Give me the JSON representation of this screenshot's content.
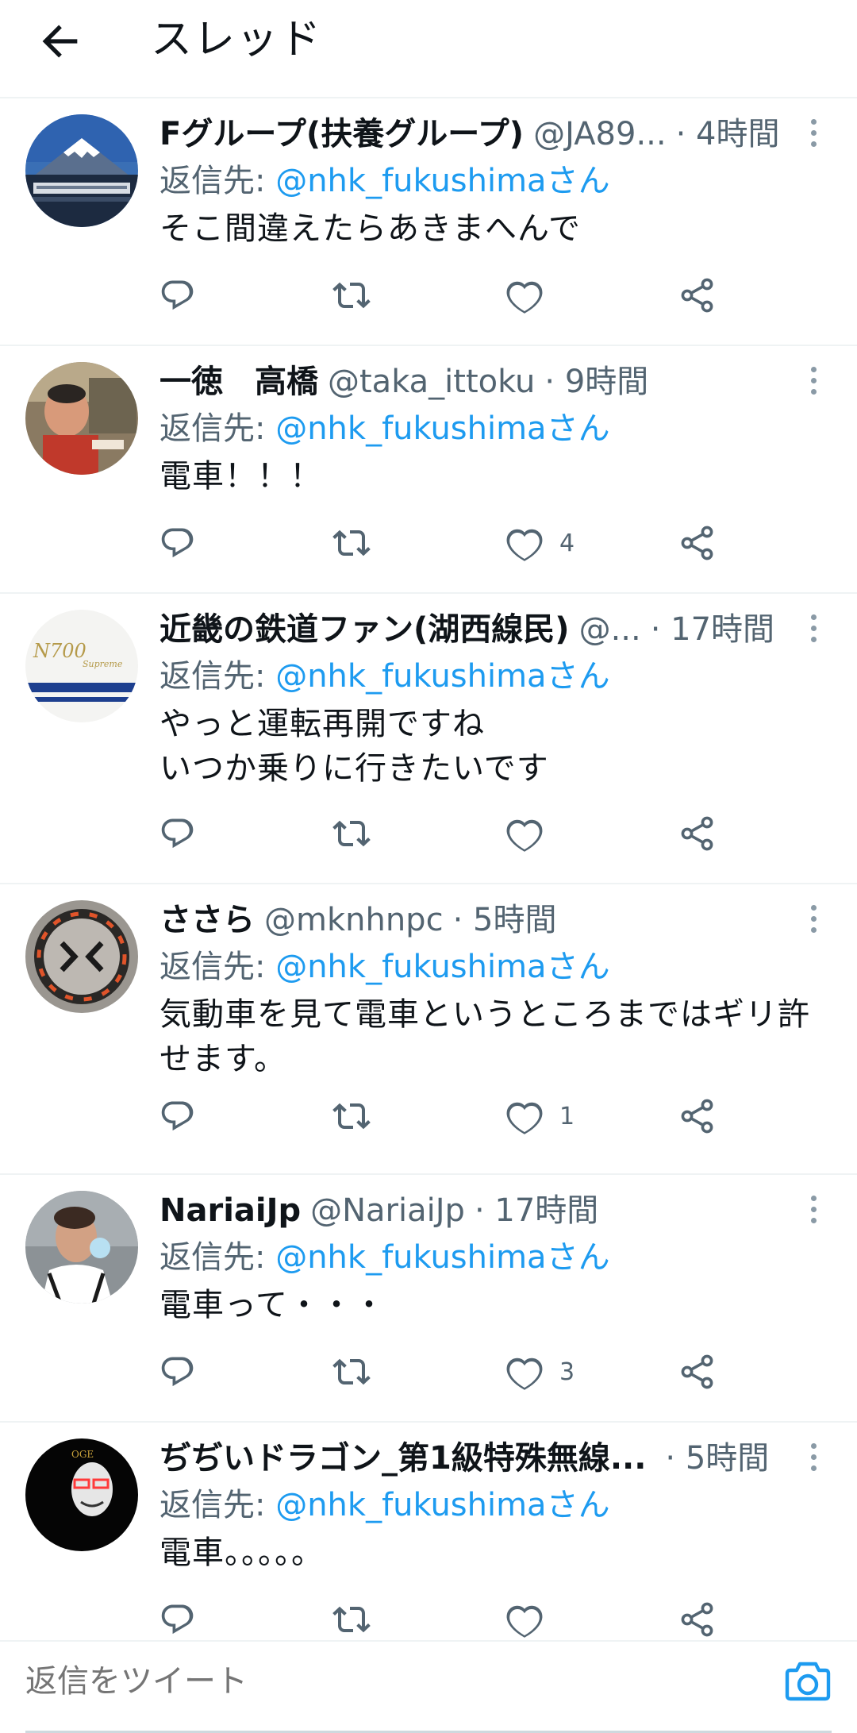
{
  "header": {
    "title": "スレッド"
  },
  "tweets": [
    {
      "name": "Fグループ(扶養グループ)",
      "handle": "@JA89...",
      "time": "· 4時間",
      "reply_prefix": "返信先: ",
      "reply_to": "@nhk_fukushimaさん",
      "text": "そこ間違えたらあきまへんで",
      "likes": ""
    },
    {
      "name": "一徳　高橋",
      "handle": "@taka_ittoku",
      "time": "· 9時間",
      "reply_prefix": "返信先: ",
      "reply_to": "@nhk_fukushimaさん",
      "text": "電車！！！",
      "likes": "4"
    },
    {
      "name": "近畿の鉄道ファン(湖西線民)",
      "handle": "@...",
      "time": "· 17時間",
      "reply_prefix": "返信先: ",
      "reply_to": "@nhk_fukushimaさん",
      "text_line1": "やっと運転再開ですね",
      "text_line2": "いつか乗りに行きたいです",
      "likes": ""
    },
    {
      "name": "ささら",
      "handle": "@mknhnpc",
      "time": "· 5時間",
      "reply_prefix": "返信先: ",
      "reply_to": "@nhk_fukushimaさん",
      "text_line1": "気動車を見て電車というところまではギリ許",
      "text_line2": "せます。",
      "likes": "1"
    },
    {
      "name": "NariaiJp",
      "handle": "@NariaiJp",
      "time": "· 17時間",
      "reply_prefix": "返信先: ",
      "reply_to": "@nhk_fukushimaさん",
      "text": "電車って・・・",
      "likes": "3"
    },
    {
      "name": "ぢぢいドラゴン_第1級特殊無線...",
      "handle": "",
      "time": "· 5時間",
      "reply_prefix": "返信先: ",
      "reply_to": "@nhk_fukushimaさん",
      "text": "電車。。。。。",
      "likes": ""
    }
  ],
  "avatar_labels": {
    "n700": "N700",
    "supreme": "Supreme",
    "oge": "OGE"
  },
  "composer": {
    "placeholder": "返信をツイート"
  },
  "colors": {
    "accent": "#1d9bf0",
    "secondary_text": "#536471",
    "divider": "#eff3f4"
  },
  "icons": [
    "back-arrow-icon",
    "more-icon",
    "reply-icon",
    "retweet-icon",
    "like-icon",
    "share-icon",
    "camera-icon"
  ]
}
